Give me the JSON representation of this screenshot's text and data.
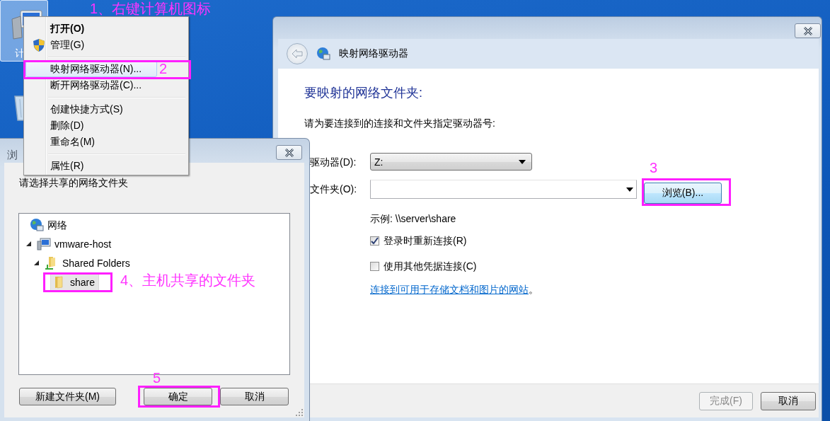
{
  "desktop": {
    "icons": [
      {
        "kind": "computer",
        "label": "计",
        "selected": true
      },
      {
        "kind": "recycle-bin",
        "selected": false
      }
    ]
  },
  "map_drive_wizard": {
    "title": "映射网络驱动器",
    "heading": "要映射的网络文件夹:",
    "instruction": "请为要连接到的连接和文件夹指定驱动器号:",
    "drive": {
      "label": "驱动器(D):",
      "value": "Z:"
    },
    "folder": {
      "label": "文件夹(O):"
    },
    "browse_button": "浏览(B)...",
    "example": "示例: \\\\server\\share",
    "options": [
      {
        "label": "登录时重新连接(R)",
        "checked": true
      },
      {
        "label": "使用其他凭据连接(C)",
        "checked": false
      }
    ],
    "link": "连接到可用于存储文档和图片的网站",
    "link_suffix": "。",
    "buttons": [
      {
        "label": "完成(F)",
        "disabled": true
      },
      {
        "label": "取消",
        "disabled": false
      }
    ]
  },
  "browse_dialog": {
    "title": "浏",
    "prompt": "请选择共享的网络文件夹",
    "tree": [
      {
        "kind": "network",
        "label": "网络",
        "selected": false,
        "children": [
          {
            "kind": "computer",
            "label": "vmware-host",
            "expanded": true,
            "selected": false,
            "children": [
              {
                "kind": "shared",
                "label": "Shared Folders",
                "expanded": true,
                "selected": false,
                "children": [
                  {
                    "kind": "folder",
                    "label": "share",
                    "selected": true
                  }
                ]
              }
            ]
          }
        ]
      }
    ],
    "buttons": [
      "新建文件夹(M)",
      "确定",
      "取消"
    ]
  },
  "context_menu": {
    "items": [
      {
        "kind": "default",
        "label": "打开(O)",
        "selected": false
      },
      {
        "kind": "shield",
        "label": "管理(G)",
        "selected": false
      },
      {
        "kind": "separator"
      },
      {
        "kind": "item",
        "label": "映射网络驱动器(N)...",
        "selected": true
      },
      {
        "kind": "item",
        "label": "断开网络驱动器(C)...",
        "selected": false
      },
      {
        "kind": "separator"
      },
      {
        "kind": "item",
        "label": "创建快捷方式(S)",
        "selected": false
      },
      {
        "kind": "item",
        "label": "删除(D)",
        "selected": false
      },
      {
        "kind": "item",
        "label": "重命名(M)",
        "selected": false
      },
      {
        "kind": "separator"
      },
      {
        "kind": "item",
        "label": "属性(R)",
        "selected": false
      }
    ]
  },
  "callouts": [
    {
      "text": "1、右键计算机图标"
    },
    {
      "text": "2"
    },
    {
      "text": "3"
    },
    {
      "text": "4、主机共享的文件夹"
    },
    {
      "text": "5"
    }
  ]
}
